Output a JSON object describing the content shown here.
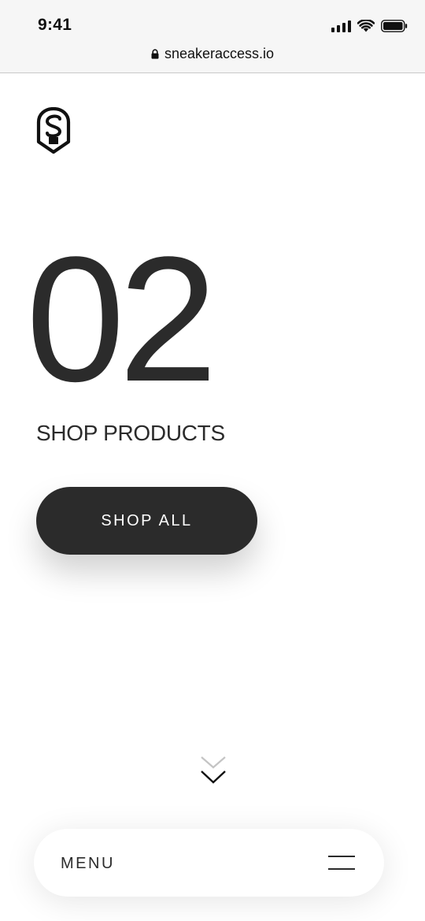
{
  "status_bar": {
    "time": "9:41",
    "icons": [
      "signal-icon",
      "wifi-icon",
      "battery-icon"
    ]
  },
  "browser": {
    "url": "sneakeraccess.io",
    "lock_icon": "lock-icon"
  },
  "brand": {
    "logo_icon": "shield-s-logo-icon"
  },
  "hero": {
    "number": "02",
    "title": "SHOP PRODUCTS",
    "button_label": "SHOP ALL"
  },
  "scroll": {
    "icon": "double-chevron-down-icon"
  },
  "menu": {
    "label": "MENU",
    "icon": "hamburger-icon"
  },
  "colors": {
    "text": "#2b2b2b",
    "button_bg": "#2b2b2b",
    "button_text": "#ffffff",
    "chrome_bg": "#f6f6f6"
  }
}
